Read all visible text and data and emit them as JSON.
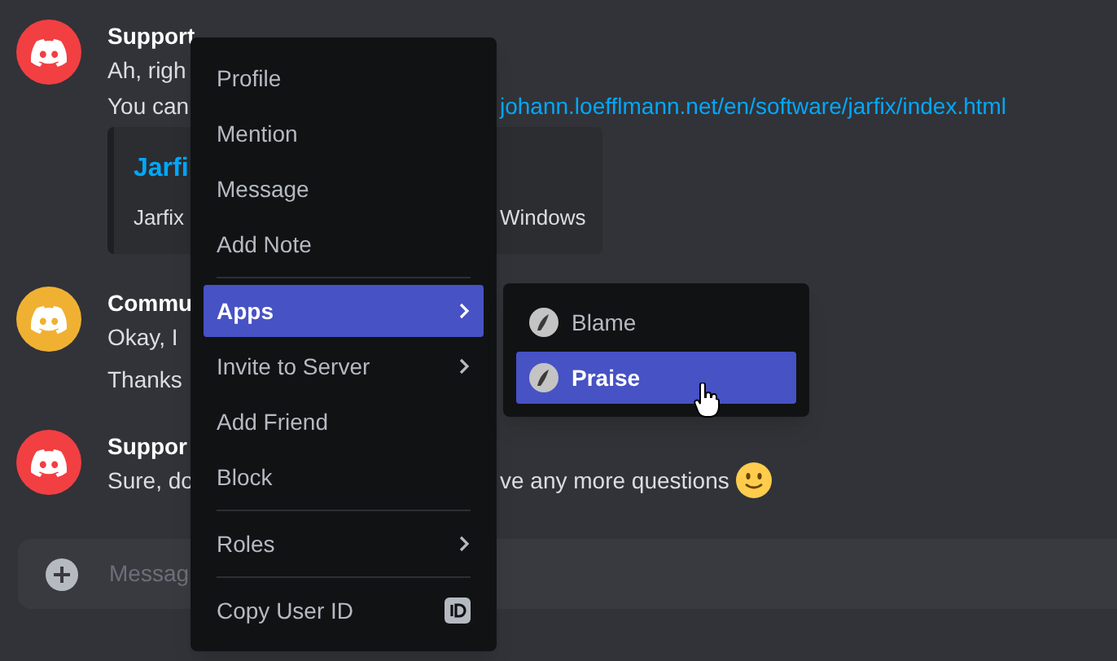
{
  "messages": [
    {
      "author": "Support",
      "color": "#f23f42",
      "lines": [
        {
          "left": "Ah, righ"
        },
        {
          "left": "You can",
          "right": {
            "kind": "link",
            "text": "johann.loefflmann.net/en/software/jarfix/index.html"
          }
        }
      ],
      "embed": {
        "title": "Jarfi",
        "description_left": "Jarfix",
        "description_right": "Windows"
      }
    },
    {
      "author": "Commu",
      "color": "#f0b132",
      "lines": [
        {
          "left": "Okay, I"
        },
        {
          "left": "Thanks"
        }
      ]
    },
    {
      "author": "Suppor",
      "color": "#f23f42",
      "lines": [
        {
          "left": "Sure, do",
          "right": {
            "kind": "text",
            "text": "ve any more questions"
          },
          "emoji": true
        }
      ]
    }
  ],
  "message_input": {
    "placeholder": "Messag"
  },
  "context_menu": [
    {
      "kind": "item",
      "label": "Profile",
      "selected": false
    },
    {
      "kind": "item",
      "label": "Mention",
      "selected": false
    },
    {
      "kind": "item",
      "label": "Message",
      "selected": false
    },
    {
      "kind": "item",
      "label": "Add Note",
      "selected": false
    },
    {
      "kind": "divider"
    },
    {
      "kind": "submenu",
      "label": "Apps",
      "selected": true
    },
    {
      "kind": "submenu",
      "label": "Invite to Server",
      "selected": false
    },
    {
      "kind": "item",
      "label": "Add Friend",
      "selected": false
    },
    {
      "kind": "item",
      "label": "Block",
      "selected": false
    },
    {
      "kind": "divider"
    },
    {
      "kind": "submenu",
      "label": "Roles",
      "selected": false
    },
    {
      "kind": "divider"
    },
    {
      "kind": "id",
      "label": "Copy User ID",
      "selected": false
    }
  ],
  "apps_submenu": [
    {
      "label": "Blame",
      "selected": false
    },
    {
      "label": "Praise",
      "selected": true
    }
  ]
}
